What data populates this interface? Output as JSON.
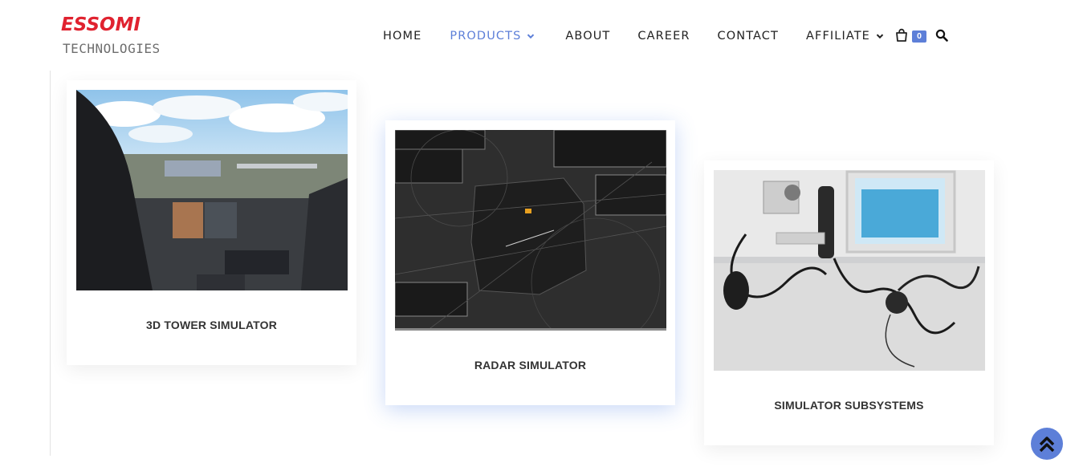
{
  "brand": {
    "name_top": "ESSOMI",
    "name_bottom": "TECHNOLOGIES"
  },
  "nav": {
    "items": [
      {
        "label": "HOME"
      },
      {
        "label": "PRODUCTS"
      },
      {
        "label": "ABOUT"
      },
      {
        "label": "CAREER"
      },
      {
        "label": "CONTACT"
      },
      {
        "label": "AFFILIATE"
      }
    ],
    "cart_count": "0"
  },
  "products": [
    {
      "title": "3D TOWER SIMULATOR",
      "image": "control-tower-simulator-photo"
    },
    {
      "title": "RADAR SIMULATOR",
      "image": "radar-display-screenshot"
    },
    {
      "title": "SIMULATOR SUBSYSTEMS",
      "image": "simulator-hardware-photo"
    }
  ],
  "colors": {
    "accent": "#5d7fd8",
    "brand_red": "#e0222f"
  },
  "icons": [
    "chevron-down-icon",
    "cart-icon",
    "search-icon",
    "chevron-double-up-icon"
  ]
}
